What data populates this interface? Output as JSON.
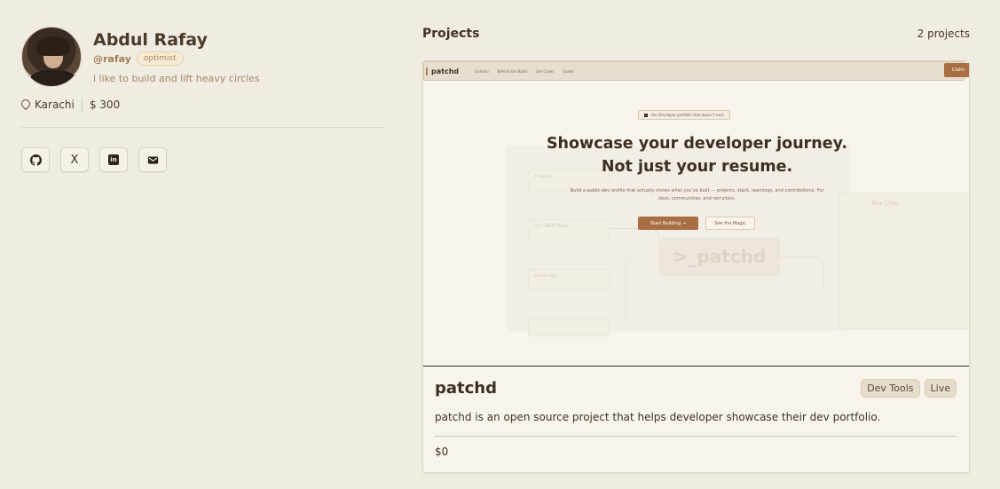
{
  "profile": {
    "name": "Abdul Rafay",
    "handle": "@rafay",
    "badge": "optimist",
    "bio": "i like to build and lift heavy circles",
    "location": "Karachi",
    "amount": "$ 300",
    "socials": [
      {
        "icon": "github-icon"
      },
      {
        "icon": "x-icon",
        "glyph": "X"
      },
      {
        "icon": "linkedin-icon",
        "glyph": "in"
      },
      {
        "icon": "mail-icon"
      }
    ]
  },
  "projects": {
    "title": "Projects",
    "count": "2 projects",
    "items": [
      {
        "name": "patchd",
        "tags": [
          "Dev Tools",
          "Live"
        ],
        "description": "patchd is an open source project that helps developer showcase their dev portfolio.",
        "price": "$0",
        "preview": {
          "logo": "patchd",
          "nav_links": [
            "Domain",
            "Behind the Build",
            "Use Cases",
            "Dudes"
          ],
          "cta": "Claim",
          "pill": "the developer portfolio that doesn't suck",
          "hero_line1": "Showcase your developer journey.",
          "hero_line2": "Not just your resume.",
          "hero_sub": "Build a public dev profile that actually shows what you've built — projects, stack, learnings, and contributions. For devs, communities, and recruiters.",
          "primary_button": "Start Building  →",
          "secondary_button": "See the Magic",
          "ghost_logo": ">_patchd",
          "ghost_items": [
            "Projects",
            "</> Tech Stack",
            "Build Logs"
          ],
          "ghost_profile": "Alex Chen"
        }
      }
    ]
  },
  "colors": {
    "background": "#f1ece1",
    "accent": "#a96f42",
    "card": "#f8f4ec"
  }
}
